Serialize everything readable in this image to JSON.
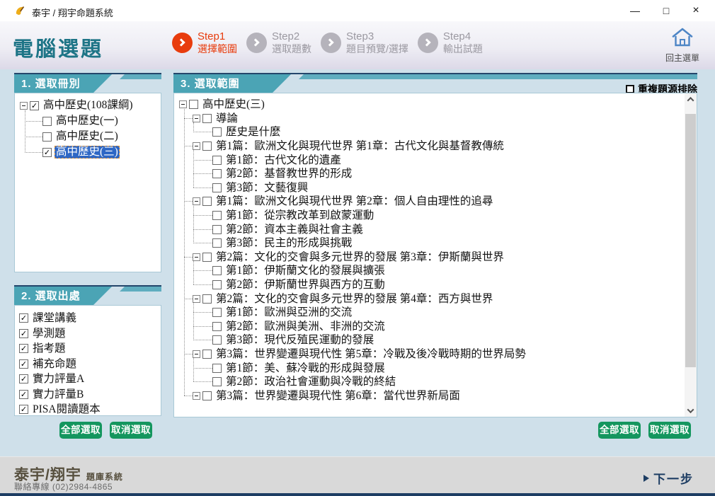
{
  "window": {
    "title": "泰宇 / 翔宇命題系統",
    "controls": {
      "minimize": "—",
      "maximize": "□",
      "close": "×"
    }
  },
  "header": {
    "page_title": "電腦選題",
    "steps": [
      {
        "name": "Step1",
        "label": "選擇範圍",
        "active": true
      },
      {
        "name": "Step2",
        "label": "選取題數",
        "active": false
      },
      {
        "name": "Step3",
        "label": "題目預覽/選擇",
        "active": false
      },
      {
        "name": "Step4",
        "label": "輸出試題",
        "active": false
      }
    ],
    "home": {
      "label": "回主選單"
    }
  },
  "panel1": {
    "title": "1. 選取冊別",
    "tree": [
      {
        "label": "高中歷史(108課綱)",
        "checked": true,
        "children": [
          {
            "label": "高中歷史(一)",
            "checked": false
          },
          {
            "label": "高中歷史(二)",
            "checked": false
          },
          {
            "label": "高中歷史(三)",
            "checked": true,
            "selected": true
          }
        ]
      }
    ]
  },
  "panel2": {
    "title": "2. 選取出處",
    "options": [
      {
        "label": "課堂講義",
        "checked": true
      },
      {
        "label": "學測題",
        "checked": true
      },
      {
        "label": "指考題",
        "checked": true
      },
      {
        "label": "補充命題",
        "checked": true
      },
      {
        "label": "實力評量A",
        "checked": true
      },
      {
        "label": "實力評量B",
        "checked": true
      },
      {
        "label": "PISA閱讀題本",
        "checked": true
      }
    ],
    "buttons": {
      "select_all": "全部選取",
      "deselect": "取消選取"
    }
  },
  "panel3": {
    "title": "3. 選取範圍",
    "dedupe": {
      "label": "重複題源排除",
      "checked": false
    },
    "tree": [
      {
        "label": "高中歷史(三)",
        "checked": false,
        "children": [
          {
            "label": "導論",
            "checked": false,
            "children": [
              {
                "label": "歷史是什麼",
                "checked": false
              }
            ]
          },
          {
            "label": "第1篇：歐洲文化與現代世界 第1章：古代文化與基督教傳統",
            "checked": false,
            "children": [
              {
                "label": "第1節：古代文化的遺產",
                "checked": false
              },
              {
                "label": "第2節：基督教世界的形成",
                "checked": false
              },
              {
                "label": "第3節：文藝復興",
                "checked": false
              }
            ]
          },
          {
            "label": "第1篇：歐洲文化與現代世界 第2章：個人自由理性的追尋",
            "checked": false,
            "children": [
              {
                "label": "第1節：從宗教改革到啟蒙運動",
                "checked": false
              },
              {
                "label": "第2節：資本主義與社會主義",
                "checked": false
              },
              {
                "label": "第3節：民主的形成與挑戰",
                "checked": false
              }
            ]
          },
          {
            "label": "第2篇：文化的交會與多元世界的發展 第3章：伊斯蘭與世界",
            "checked": false,
            "children": [
              {
                "label": "第1節：伊斯蘭文化的發展與擴張",
                "checked": false
              },
              {
                "label": "第2節：伊斯蘭世界與西方的互動",
                "checked": false
              }
            ]
          },
          {
            "label": "第2篇：文化的交會與多元世界的發展 第4章：西方與世界",
            "checked": false,
            "children": [
              {
                "label": "第1節：歐洲與亞洲的交流",
                "checked": false
              },
              {
                "label": "第2節：歐洲與美洲、非洲的交流",
                "checked": false
              },
              {
                "label": "第3節：現代反殖民運動的發展",
                "checked": false
              }
            ]
          },
          {
            "label": "第3篇：世界變遷與現代性 第5章：冷戰及後冷戰時期的世界局勢",
            "checked": false,
            "children": [
              {
                "label": "第1節：美、蘇冷戰的形成與發展",
                "checked": false
              },
              {
                "label": "第2節：政治社會運動與冷戰的終結",
                "checked": false
              }
            ]
          },
          {
            "label": "第3篇：世界變遷與現代性 第6章：當代世界新局面",
            "checked": false,
            "children": []
          }
        ]
      }
    ],
    "buttons": {
      "select_all": "全部選取",
      "deselect": "取消選取"
    }
  },
  "footer": {
    "brand": "泰宇/翔宇",
    "brand_suffix": "題庫系統",
    "contact": "聯絡專線 (02)2984-4865",
    "next_label": "下一步"
  },
  "colors": {
    "teal": "#4ba4b5",
    "step_active": "#e83c0d",
    "step_inactive": "#b5b3bb",
    "green_button": "#14965e",
    "selection_blue": "#2e67c5",
    "navy": "#1d3d63"
  }
}
